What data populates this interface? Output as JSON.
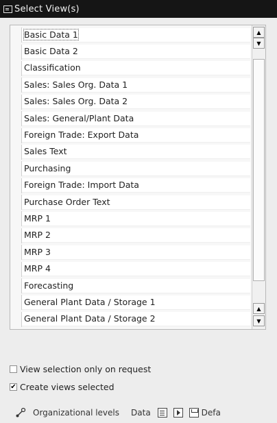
{
  "window": {
    "title": "Select View(s)",
    "title_icon": "dialog-window-icon"
  },
  "views": [
    {
      "label": "Basic Data 1",
      "focused": true
    },
    {
      "label": "Basic Data 2"
    },
    {
      "label": "Classification"
    },
    {
      "label": "Sales: Sales Org. Data 1"
    },
    {
      "label": "Sales: Sales Org. Data 2"
    },
    {
      "label": "Sales: General/Plant Data"
    },
    {
      "label": "Foreign Trade: Export Data"
    },
    {
      "label": "Sales Text"
    },
    {
      "label": "Purchasing"
    },
    {
      "label": "Foreign Trade: Import Data"
    },
    {
      "label": "Purchase Order Text"
    },
    {
      "label": "MRP 1"
    },
    {
      "label": "MRP 2"
    },
    {
      "label": "MRP 3"
    },
    {
      "label": "MRP 4"
    },
    {
      "label": "Forecasting"
    },
    {
      "label": "General Plant Data / Storage 1"
    },
    {
      "label": "General Plant Data / Storage 2"
    }
  ],
  "options": {
    "view_selection_only_on_request": {
      "label": "View selection only on request",
      "checked": false
    },
    "create_views_selected": {
      "label": "Create views selected",
      "checked": true,
      "check_glyph": "✔"
    }
  },
  "toolbar": {
    "org_levels_label": "Organizational levels",
    "data_label": "Data",
    "default_label": "Defa"
  },
  "scroll_glyphs": {
    "up": "▲",
    "down": "▼"
  },
  "colors": {
    "titlebar": "#151515",
    "dialog_bg": "#ededed",
    "list_bg": "#ffffff"
  }
}
